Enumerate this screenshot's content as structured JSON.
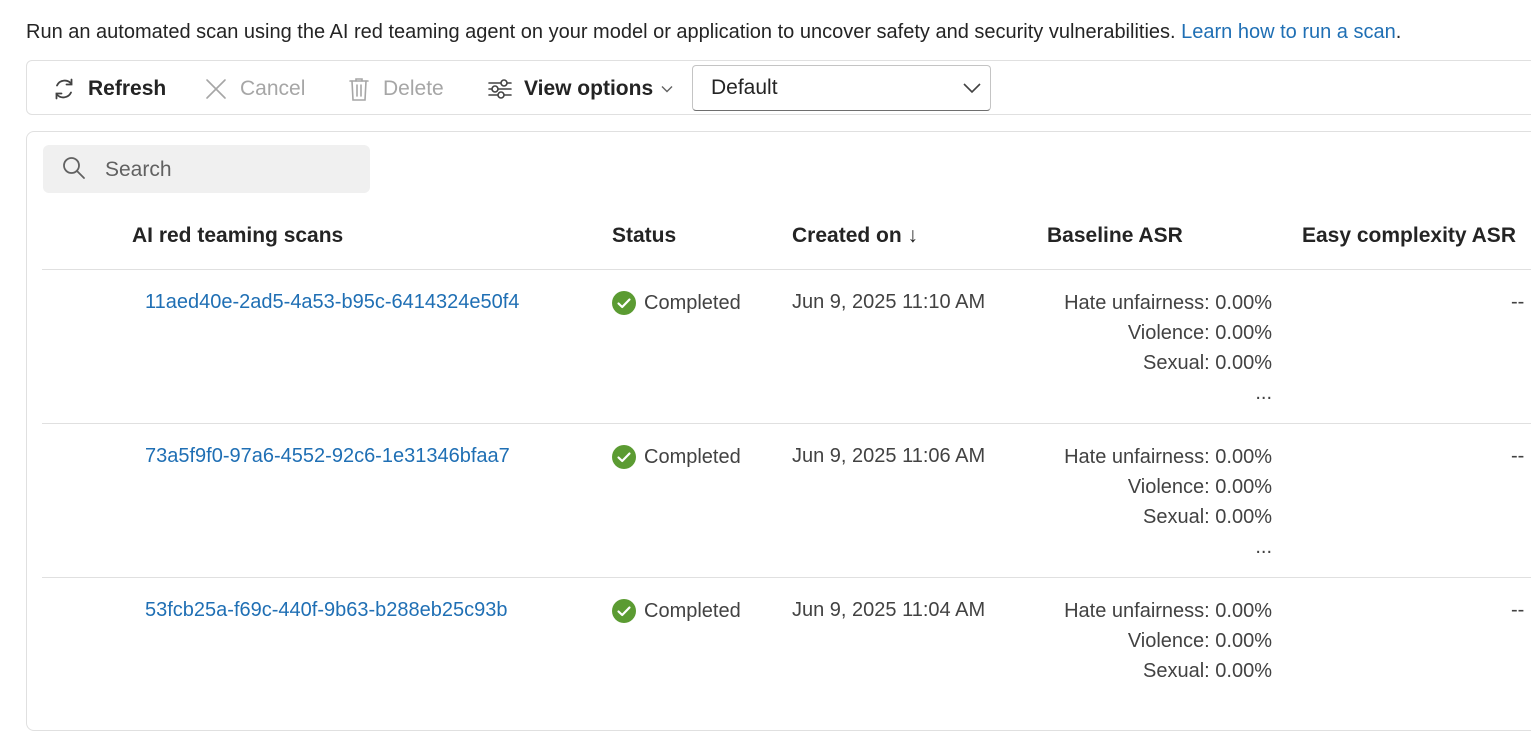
{
  "intro": {
    "text": "Run an automated scan using the AI red teaming agent on your model or application to uncover safety and security vulnerabilities.",
    "link": "Learn how to run a scan",
    "period": "."
  },
  "toolbar": {
    "refresh_label": "Refresh",
    "cancel_label": "Cancel",
    "delete_label": "Delete",
    "view_options_label": "View options",
    "view_select_value": "Default"
  },
  "search": {
    "placeholder": "Search"
  },
  "table": {
    "headers": {
      "name": "AI red teaming scans",
      "status": "Status",
      "created": "Created on ↓",
      "baseline": "Baseline ASR",
      "easy": "Easy complexity ASR"
    },
    "rows": [
      {
        "name": "11aed40e-2ad5-4a53-b95c-6414324e50f4",
        "status": "Completed",
        "created": "Jun 9, 2025 11:10 AM",
        "asr": [
          "Hate unfairness: 0.00%",
          "Violence: 0.00%",
          "Sexual: 0.00%",
          "..."
        ],
        "easy": "--"
      },
      {
        "name": "73a5f9f0-97a6-4552-92c6-1e31346bfaa7",
        "status": "Completed",
        "created": "Jun 9, 2025 11:06 AM",
        "asr": [
          "Hate unfairness: 0.00%",
          "Violence: 0.00%",
          "Sexual: 0.00%",
          "..."
        ],
        "easy": "--"
      },
      {
        "name": "53fcb25a-f69c-440f-9b63-b288eb25c93b",
        "status": "Completed",
        "created": "Jun 9, 2025 11:04 AM",
        "asr": [
          "Hate unfairness: 0.00%",
          "Violence: 0.00%",
          "Sexual: 0.00%"
        ],
        "easy": "--"
      }
    ]
  },
  "colors": {
    "link": "#1f6fb4",
    "success": "#5b9b32",
    "disabled": "#a6a6a6"
  },
  "icons": {
    "refresh": "refresh-icon",
    "cancel": "close-icon",
    "delete": "trash-icon",
    "view_options": "sliders-icon",
    "search": "search-icon",
    "status": "check-circle-icon"
  }
}
